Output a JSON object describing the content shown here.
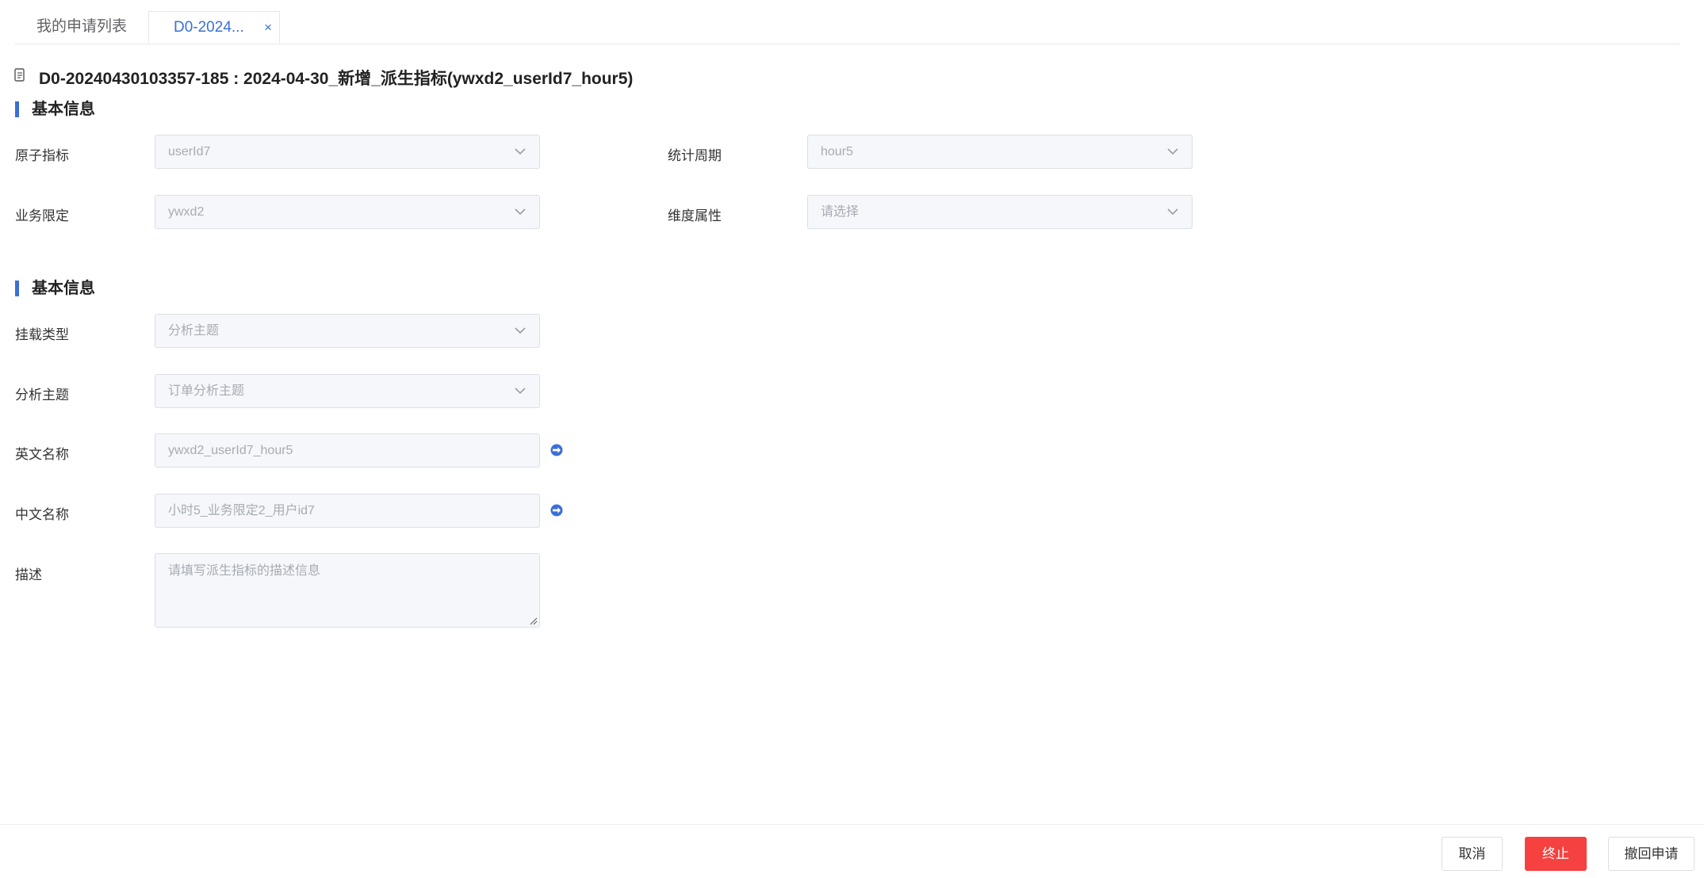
{
  "tabs": [
    {
      "label": "我的申请列表"
    },
    {
      "label": "D0-2024...",
      "close": "×"
    }
  ],
  "page_title": "D0-20240430103357-185 : 2024-04-30_新增_派生指标(ywxd2_userId7_hour5)",
  "section1": {
    "title": "基本信息",
    "fields": {
      "atomic_metric": {
        "label": "原子指标",
        "value": "userId7"
      },
      "stat_period": {
        "label": "统计周期",
        "value": "hour5"
      },
      "business_limit": {
        "label": "业务限定",
        "value": "ywxd2"
      },
      "dimension_attr": {
        "label": "维度属性",
        "placeholder": "请选择"
      }
    }
  },
  "section2": {
    "title": "基本信息",
    "fields": {
      "mount_type": {
        "label": "挂载类型",
        "value": "分析主题"
      },
      "analysis_topic": {
        "label": "分析主题",
        "value": "订单分析主题"
      },
      "english_name": {
        "label": "英文名称",
        "value": "ywxd2_userId7_hour5"
      },
      "chinese_name": {
        "label": "中文名称",
        "value": "小时5_业务限定2_用户id7"
      },
      "description": {
        "label": "描述",
        "placeholder": "请填写派生指标的描述信息"
      }
    }
  },
  "footer": {
    "cancel": "取消",
    "stop": "终止",
    "withdraw": "撤回申请"
  },
  "colors": {
    "accent": "#3a6fd8",
    "danger": "#f5413f"
  }
}
